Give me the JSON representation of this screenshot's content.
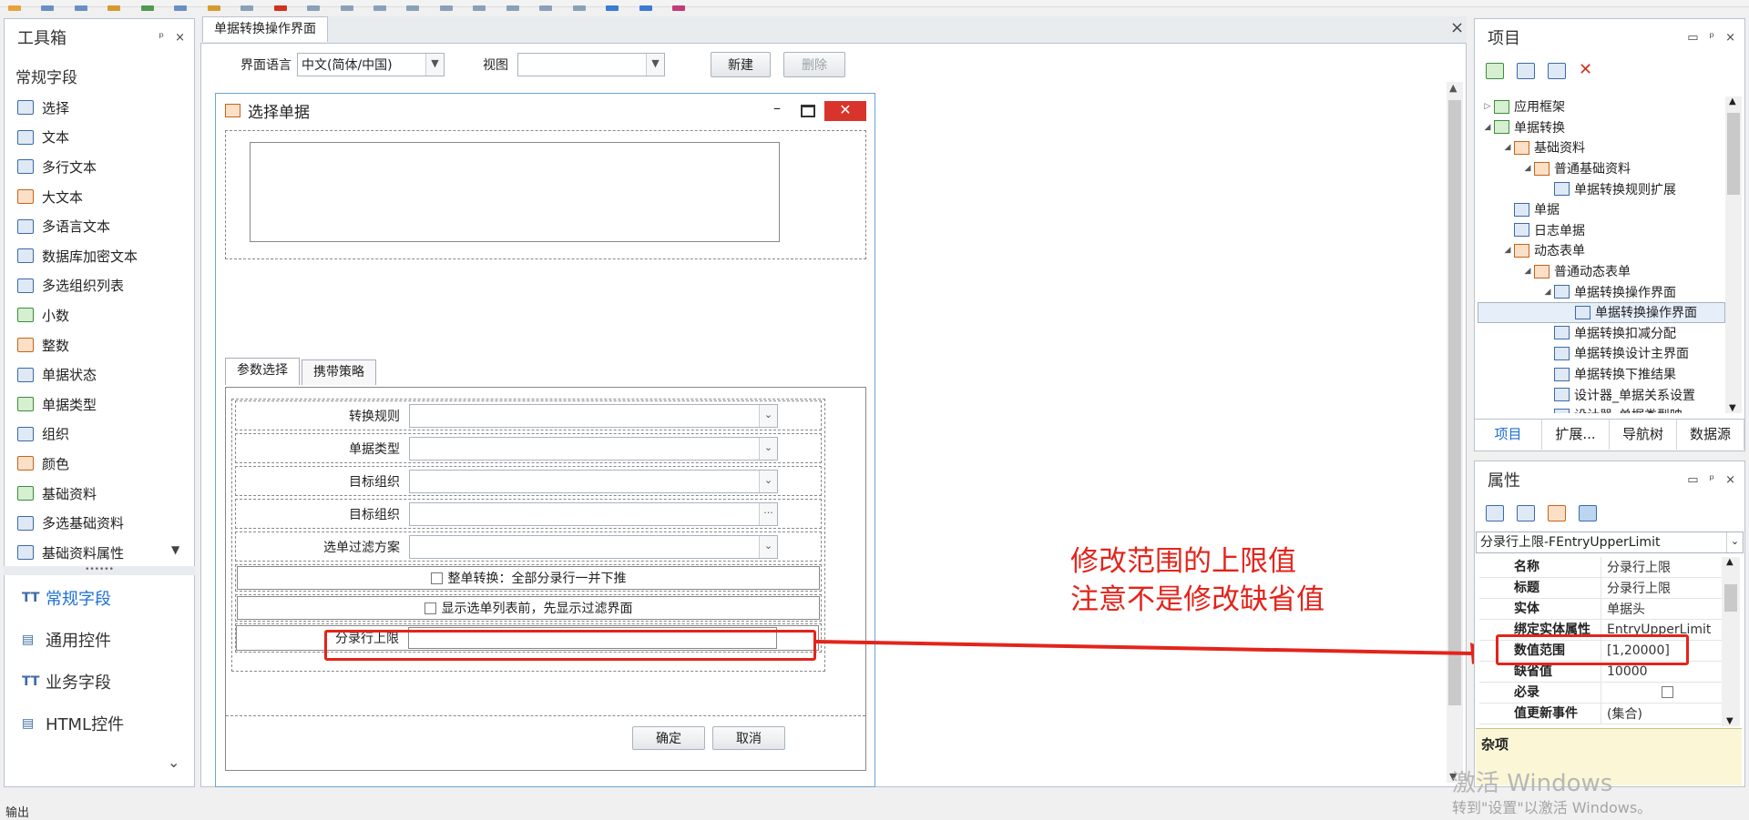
{
  "toolbox": {
    "title": "工具箱",
    "pin": "ᵖ",
    "close": "×",
    "group": "常规字段",
    "items": [
      "选择",
      "文本",
      "多行文本",
      "大文本",
      "多语言文本",
      "数据库加密文本",
      "多选组织列表",
      "小数",
      "整数",
      "单据状态",
      "单据类型",
      "组织",
      "颜色",
      "基础资料",
      "多选基础资料",
      "基础资料属性"
    ],
    "more": "▼",
    "grip": "••••••",
    "categories": [
      "常规字段",
      "通用控件",
      "业务字段",
      "HTML控件"
    ],
    "cat_more": "⌄"
  },
  "document": {
    "tab": "单据转换操作界面",
    "close": "×",
    "lang_label": "界面语言",
    "lang_value": "中文(简体/中国)",
    "view_label": "视图",
    "view_value": "",
    "new_btn": "新建",
    "delete_btn": "删除"
  },
  "dialog": {
    "title": "选择单据",
    "min": "–",
    "close": "✕",
    "tabs": [
      "参数选择",
      "携带策略"
    ],
    "fields": [
      "转换规则",
      "单据类型",
      "目标组织",
      "目标组织",
      "选单过滤方案"
    ],
    "ellipsis": "···",
    "checkbox1": "整单转换：全部分录行一并下推",
    "checkbox2": "显示选单列表前，先显示过滤界面",
    "upper_limit_label": "分录行上限",
    "ok": "确定",
    "cancel": "取消"
  },
  "annotation": {
    "line1": "修改范围的上限值",
    "line2": "注意不是修改缺省值",
    "color": "#e3241b"
  },
  "project": {
    "title": "项目",
    "tree": [
      {
        "label": "应用框架",
        "depth": 0,
        "twisty": "▷"
      },
      {
        "label": "单据转换",
        "depth": 0,
        "twisty": "◢"
      },
      {
        "label": "基础资料",
        "depth": 1,
        "twisty": "◢"
      },
      {
        "label": "普通基础资料",
        "depth": 2,
        "twisty": "◢"
      },
      {
        "label": "单据转换规则扩展",
        "depth": 3,
        "twisty": ""
      },
      {
        "label": "单据",
        "depth": 1,
        "twisty": ""
      },
      {
        "label": "日志单据",
        "depth": 1,
        "twisty": ""
      },
      {
        "label": "动态表单",
        "depth": 1,
        "twisty": "◢"
      },
      {
        "label": "普通动态表单",
        "depth": 2,
        "twisty": "◢"
      },
      {
        "label": "单据转换操作界面",
        "depth": 3,
        "twisty": "◢"
      },
      {
        "label": "单据转换操作界面",
        "depth": 4,
        "twisty": "",
        "selected": true
      },
      {
        "label": "单据转换扣减分配",
        "depth": 3,
        "twisty": ""
      },
      {
        "label": "单据转换设计主界面",
        "depth": 3,
        "twisty": ""
      },
      {
        "label": "单据转换下推结果",
        "depth": 3,
        "twisty": ""
      },
      {
        "label": "设计器_单据关系设置",
        "depth": 3,
        "twisty": ""
      },
      {
        "label": "设计器_单据类型映",
        "depth": 3,
        "twisty": ""
      }
    ],
    "tabs": [
      "项目",
      "扩展...",
      "导航树",
      "数据源"
    ]
  },
  "properties": {
    "title": "属性",
    "object": "分录行上限-FEntryUpperLimit",
    "rows": [
      {
        "name": "名称",
        "value": "分录行上限"
      },
      {
        "name": "标题",
        "value": "分录行上限"
      },
      {
        "name": "实体",
        "value": "单据头"
      },
      {
        "name": "绑定实体属性",
        "value": "EntryUpperLimit"
      },
      {
        "name": "数值范围",
        "value": "[1,20000]"
      },
      {
        "name": "缺省值",
        "value": "10000"
      },
      {
        "name": "必录",
        "value": ""
      },
      {
        "name": "值更新事件",
        "value": "(集合)"
      }
    ],
    "misc": "杂项"
  },
  "watermark": {
    "line1": "激活 Windows",
    "line2": "转到\"设置\"以激活 Windows。"
  },
  "output_label": "输出"
}
